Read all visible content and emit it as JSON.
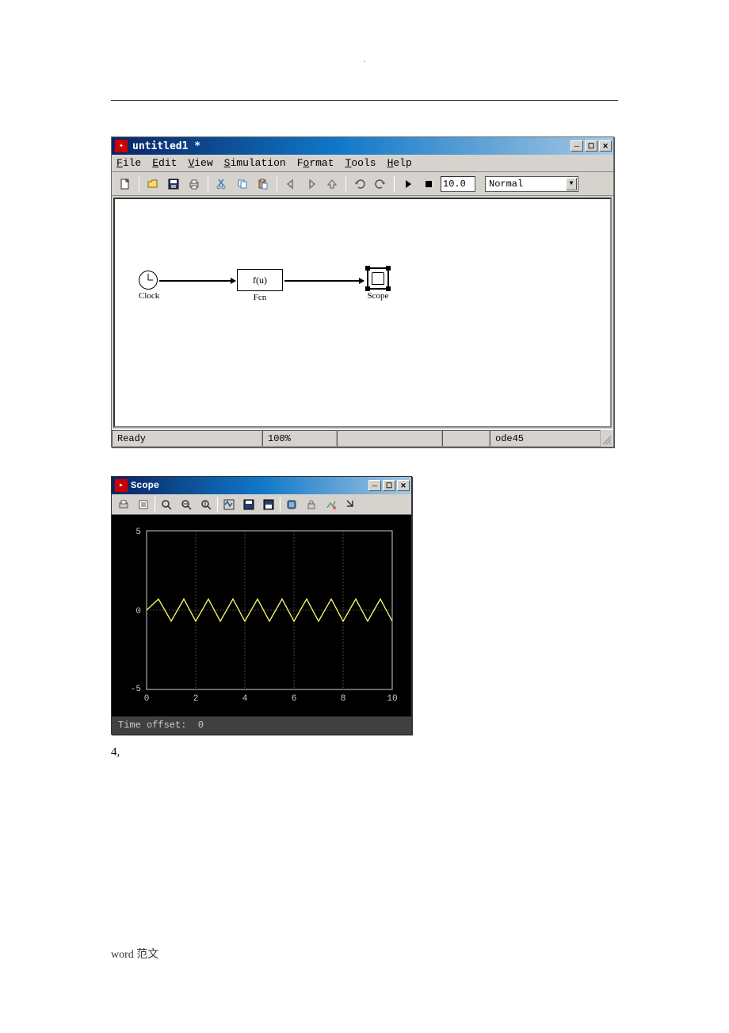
{
  "header_dot": ".",
  "simulink": {
    "title": "untitled1 *",
    "menus": [
      "File",
      "Edit",
      "View",
      "Simulation",
      "Format",
      "Tools",
      "Help"
    ],
    "stop_time": "10.0",
    "mode": "Normal",
    "blocks": {
      "clock": "Clock",
      "fcn_expr": "f(u)",
      "fcn": "Fcn",
      "scope": "Scope"
    },
    "status": {
      "ready": "Ready",
      "zoom": "100%",
      "solver": "ode45"
    }
  },
  "scope": {
    "title": "Scope",
    "offset_label": "Time offset:",
    "offset_value": "0",
    "y_ticks": [
      "5",
      "0",
      "-5"
    ],
    "x_ticks": [
      "0",
      "2",
      "4",
      "6",
      "8",
      "10"
    ]
  },
  "below": "4,",
  "footer": "word 范文"
}
